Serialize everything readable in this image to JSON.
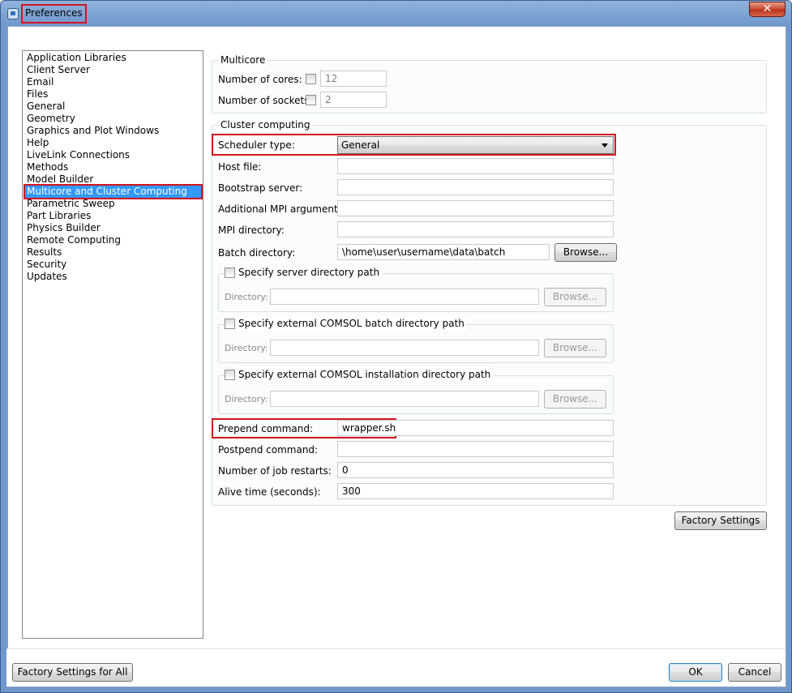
{
  "window": {
    "title": "Preferences",
    "close_glyph": "✕"
  },
  "tree": {
    "items": [
      "Application Libraries",
      "Client Server",
      "Email",
      "Files",
      "General",
      "Geometry",
      "Graphics and Plot Windows",
      "Help",
      "LiveLink Connections",
      "Methods",
      "Model Builder",
      "Multicore and Cluster Computing",
      "Parametric Sweep",
      "Part Libraries",
      "Physics Builder",
      "Remote Computing",
      "Results",
      "Security",
      "Updates"
    ],
    "selected": "Multicore and Cluster Computing"
  },
  "multicore": {
    "title": "Multicore",
    "cores_label": "Number of cores:",
    "cores_value": "12",
    "sockets_label": "Number of sockets:",
    "sockets_value": "2"
  },
  "cluster": {
    "title": "Cluster computing",
    "scheduler_label": "Scheduler type:",
    "scheduler_value": "General",
    "host_file_label": "Host file:",
    "host_file_value": "",
    "bootstrap_label": "Bootstrap server:",
    "bootstrap_value": "",
    "mpi_args_label": "Additional MPI arguments:",
    "mpi_args_value": "",
    "mpi_dir_label": "MPI directory:",
    "mpi_dir_value": "",
    "batch_dir_label": "Batch directory:",
    "batch_dir_value": "\\home\\user\\username\\data\\batch",
    "browse_label": "Browse...",
    "server_dir_check": "Specify server directory path",
    "batch_path_check": "Specify external COMSOL batch directory path",
    "install_path_check": "Specify external COMSOL installation directory path",
    "directory_label": "Directory:",
    "prepend_label": "Prepend command:",
    "prepend_value": "wrapper.sh",
    "postpend_label": "Postpend command:",
    "postpend_value": "",
    "restarts_label": "Number of job restarts:",
    "restarts_value": "0",
    "alive_label": "Alive time (seconds):",
    "alive_value": "300"
  },
  "buttons": {
    "factory_settings": "Factory Settings",
    "factory_settings_all": "Factory Settings for All",
    "ok": "OK",
    "cancel": "Cancel"
  }
}
